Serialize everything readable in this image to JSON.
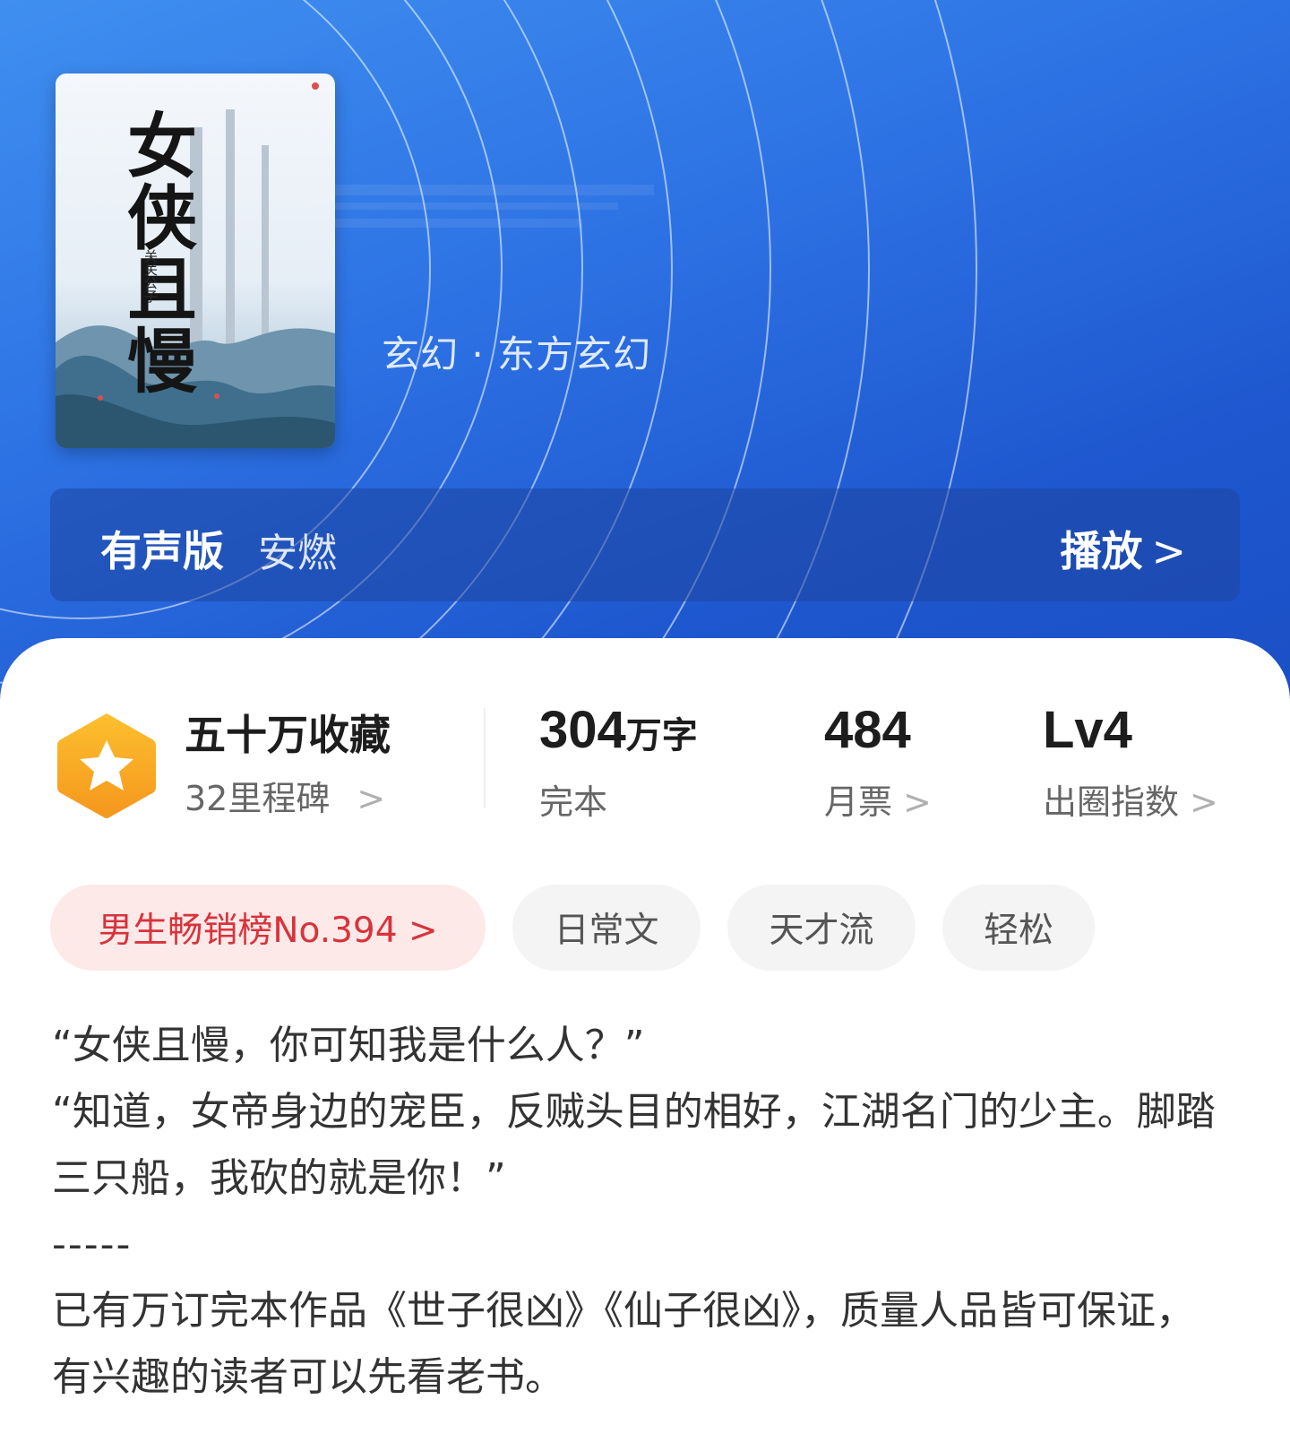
{
  "book": {
    "cover_title": "女侠且慢",
    "cover_author": "关关公子",
    "genre": "玄幻 · 东方玄幻"
  },
  "audio": {
    "label": "有声版",
    "narrator": "安燃",
    "play_label": "播放",
    "chevron": ">"
  },
  "stats": {
    "favorites": "五十万收藏",
    "milestone": "32里程碑",
    "words_value": "304",
    "words_unit": "万字",
    "status": "完本",
    "monthly_votes_value": "484",
    "monthly_votes_label": "月票",
    "level_value": "Lv4",
    "level_label": "出圈指数",
    "chevron": ">"
  },
  "tags": {
    "rank": "男生畅销榜No.394 >",
    "items": [
      "日常文",
      "天才流",
      "轻松"
    ]
  },
  "description": {
    "line1": "“女侠且慢，你可知我是什么人？”",
    "line2": "“知道，女帝身边的宠臣，反贼头目的相好，江湖名门的少主。脚踏三只船，我砍的就是你！”",
    "separator": "-----",
    "line3": "已有万订完本作品《世子很凶》《仙子很凶》，质量人品皆可保证，有兴趣的读者可以先看老书。"
  },
  "colors": {
    "hero_blue": "#2d72e4",
    "rank_red": "#d8333b",
    "badge_orange": "#f9a825"
  },
  "icons": {
    "badge": "star-hexagon-icon",
    "chevron": "chevron-right-icon"
  }
}
